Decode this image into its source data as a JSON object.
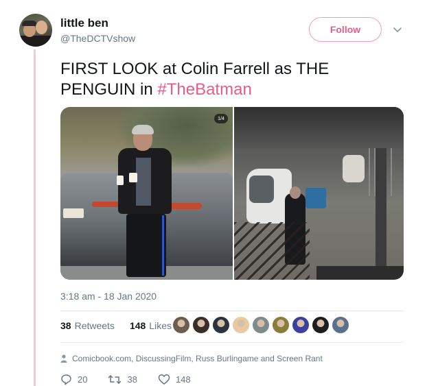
{
  "author": {
    "name": "little ben",
    "handle": "@TheDCTVshow"
  },
  "follow_button": {
    "label": "Follow"
  },
  "tweet": {
    "text": "FIRST LOOK at Colin Farrell as THE PENGUIN in ",
    "hashtag": "#TheBatman"
  },
  "media": {
    "counter": "1/4"
  },
  "timestamp": "3:18 am - 18 Jan 2020",
  "stats": {
    "retweets_count": "38",
    "retweets_label": "Retweets",
    "likes_count": "148",
    "likes_label": "Likes"
  },
  "likers": [
    {
      "name": "liker-1",
      "color": "#6b5e4f"
    },
    {
      "name": "liker-2",
      "color": "#3a2e2a"
    },
    {
      "name": "liker-3",
      "color": "#2c3340"
    },
    {
      "name": "liker-4",
      "color": "#e8c9a0"
    },
    {
      "name": "liker-5",
      "color": "#7e8a8c"
    },
    {
      "name": "liker-6",
      "color": "#8a7c3a"
    },
    {
      "name": "liker-7",
      "color": "#3b3fa0"
    },
    {
      "name": "liker-8",
      "color": "#1d1d1d"
    },
    {
      "name": "liker-9",
      "color": "#5b6f8f"
    }
  ],
  "cards_line": "Comicbook.com, DiscussingFilm, Russ Burlingame and Screen Rant",
  "actions": {
    "reply_count": "20",
    "retweet_count": "38",
    "like_count": "148"
  },
  "colors": {
    "accent_pink": "#e85d88",
    "thread_line": "#f5c6d6",
    "secondary_text": "#657786"
  },
  "icons": {
    "chevron": "chevron-down-icon",
    "cards": "person-icon",
    "reply": "reply-icon",
    "retweet": "retweet-icon",
    "like": "heart-icon"
  }
}
